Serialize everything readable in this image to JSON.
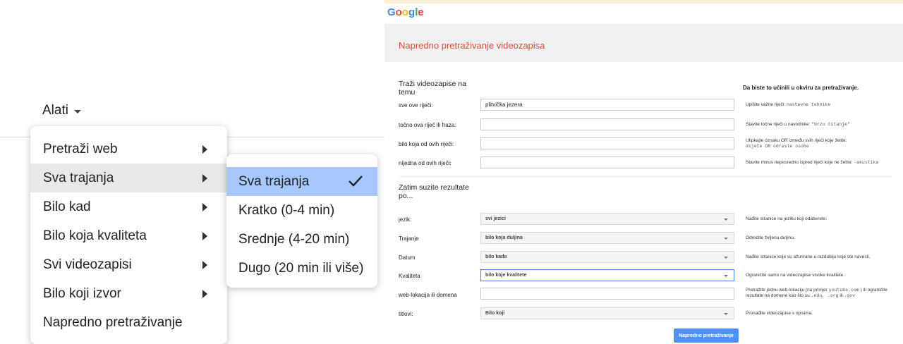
{
  "tools": {
    "label": "Alati"
  },
  "menu": {
    "items": [
      {
        "label": "Pretraži web",
        "has_submenu": true
      },
      {
        "label": "Sva trajanja",
        "has_submenu": true,
        "active": true
      },
      {
        "label": "Bilo kad",
        "has_submenu": true
      },
      {
        "label": "Bilo koja kvaliteta",
        "has_submenu": true
      },
      {
        "label": "Svi videozapisi",
        "has_submenu": true
      },
      {
        "label": "Bilo koji izvor",
        "has_submenu": true
      },
      {
        "label": "Napredno pretraživanje",
        "has_submenu": false
      }
    ]
  },
  "submenu": {
    "items": [
      {
        "label": "Sva trajanja",
        "selected": true
      },
      {
        "label": "Kratko (0-4 min)"
      },
      {
        "label": "Srednje (4-20 min)"
      },
      {
        "label": "Dugo (20 min ili više)"
      }
    ]
  },
  "advanced": {
    "logo": "Google",
    "logo_colors": [
      "#4285f4",
      "#ea4335",
      "#fbbc05",
      "#4285f4",
      "#34a853",
      "#ea4335"
    ],
    "title": "Napredno pretraživanje videozapisa",
    "section1": {
      "heading": "Traži videozapise na temu",
      "hint": "Da biste to učinili u okviru za pretraživanje."
    },
    "rows1": [
      {
        "label": "sve ove riječi:",
        "value": "plitvička jezera",
        "help_text": "Upišite važne riječi:",
        "help_example": "nastavne tehnike"
      },
      {
        "label": "točno ova riječ ili fraza:",
        "value": "",
        "help_text": "Stavite točne riječi u navodnike:",
        "help_example": "\"brzo čitanje\""
      },
      {
        "label": "bilo koja od ovih riječi:",
        "value": "",
        "help_text": "Utipkajte oznaku OR između svih riječi koje želite:",
        "help_example": "dijete OR odrasle osobe"
      },
      {
        "label": "nijedna od ovih riječi:",
        "value": "",
        "help_text": "Stavite minus neposredno ispred riječi koje ne želite:",
        "help_example": "-akustika"
      }
    ],
    "section2": {
      "heading": "Zatim suzite rezultate po..."
    },
    "rows2": [
      {
        "label": "jezik:",
        "type": "select",
        "value": "svi jezici",
        "help": "Nađite stranice na jeziku koji odaberete."
      },
      {
        "label": "Trajanje",
        "type": "select",
        "value": "bilo koja duljina",
        "help": "Odredite željenu duljinu."
      },
      {
        "label": "Datum",
        "type": "select",
        "value": "bilo kada",
        "help": "Nađite stranice koje su ažurirane u razdoblju koje ste navesli."
      },
      {
        "label": "Kvaliteta",
        "type": "select",
        "value": "bilo koje kvalitete",
        "help": "Ograničite samo na videozapise visoke kvalitete.",
        "active": true
      },
      {
        "label": "web-lokacija ili domena",
        "type": "input",
        "value": "",
        "help_parts": [
          "Pretražite jednu web-lokaciju (na primjer",
          "youtube.com",
          ") ili ograničite rezultate na domene kao što su",
          ".edu, .org",
          "ili",
          ".gov"
        ]
      },
      {
        "label": "titlovi:",
        "type": "select",
        "value": "Bilo koji",
        "help": "Pronađite videozapise s opisima."
      }
    ],
    "submit_label": "Napredno pretraživanje"
  }
}
